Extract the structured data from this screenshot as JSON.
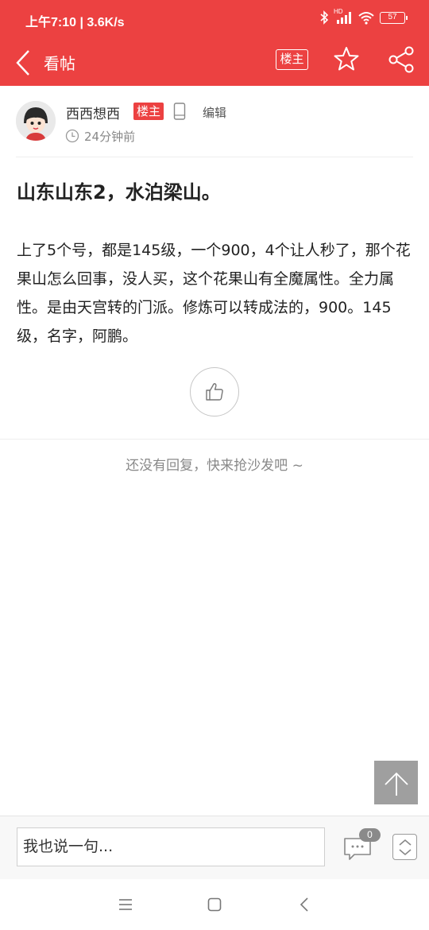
{
  "status_bar": {
    "time_speed": "上午7:10 | 3.6K/s",
    "hd_label": "HD",
    "battery": "57"
  },
  "nav": {
    "title": "看帖",
    "owner_only_label": "楼主"
  },
  "author": {
    "name": "西西想西",
    "badge": "楼主",
    "edit_label": "编辑",
    "time": "24分钟前"
  },
  "post": {
    "title": "山东山东2，水泊梁山。",
    "body": "上了5个号，都是145级，一个900，4个让人秒了，那个花果山怎么回事，没人买，这个花果山有全魔属性。全力属性。是由天宫转的门派。修炼可以转成法的，900。145级，名字，阿鹏。"
  },
  "replies": {
    "empty_text": "还没有回复，快来抢沙发吧 ~"
  },
  "bottom_bar": {
    "input_placeholder": "我也说一句...",
    "comment_count": "0"
  },
  "colors": {
    "brand_red": "#ec4141",
    "back_top_gray": "#9f9f9f"
  }
}
